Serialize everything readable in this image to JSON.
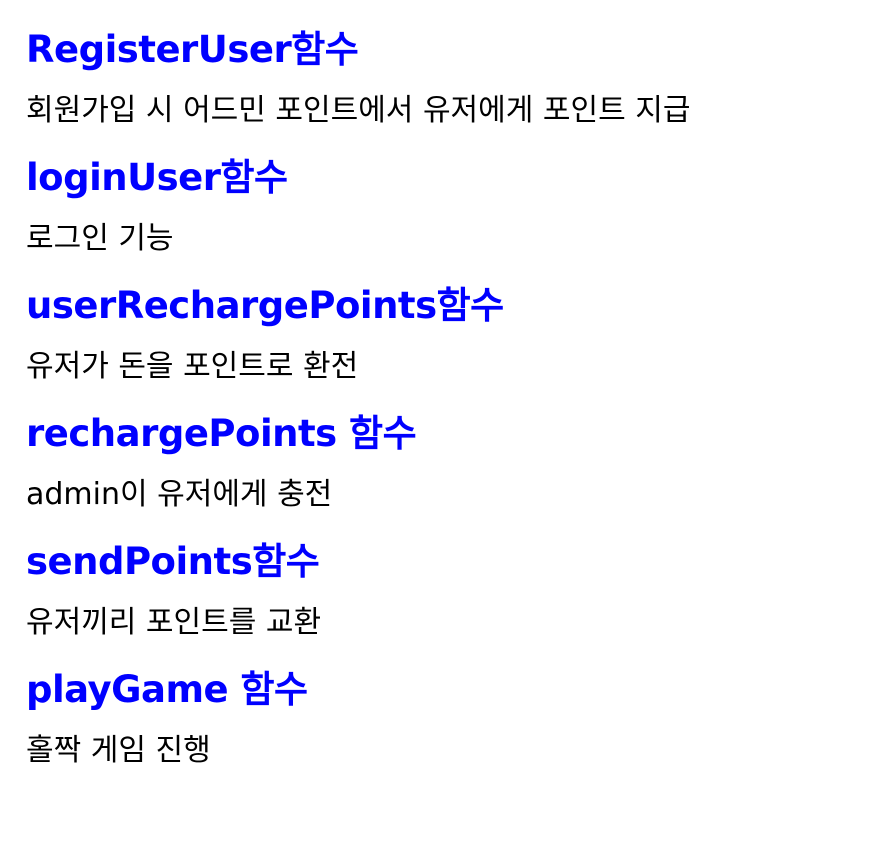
{
  "sections": [
    {
      "title": "RegisterUser함수",
      "description": "회원가입 시 어드민 포인트에서 유저에게 포인트 지급"
    },
    {
      "title": "loginUser함수",
      "description": "로그인 기능"
    },
    {
      "title": "userRechargePoints함수",
      "description": "유저가 돈을 포인트로 환전"
    },
    {
      "title": "rechargePoints 함수",
      "description": "admin이 유저에게 충전"
    },
    {
      "title": "sendPoints함수",
      "description": "유저끼리 포인트를 교환"
    },
    {
      "title": "playGame 함수",
      "description": "홀짝 게임 진행"
    }
  ],
  "colors": {
    "heading": "#0000ff",
    "text": "#000000",
    "background": "#ffffff"
  }
}
